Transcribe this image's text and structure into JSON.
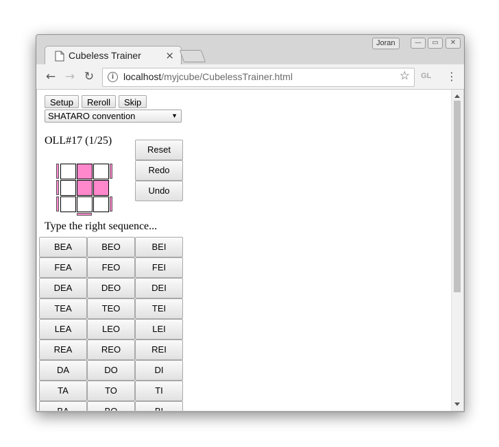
{
  "browser": {
    "tab_title": "Cubeless Trainer",
    "tab_close": "×",
    "profile_name": "Joran",
    "url_host": "localhost",
    "url_path": "/myjcube/CubelessTrainer.html",
    "gl_label": "GL",
    "back_glyph": "←",
    "forward_glyph": "→",
    "reload_glyph": "↻",
    "star_glyph": "☆",
    "menu_glyph": "⋮",
    "info_glyph": "i",
    "minimize_glyph": "—",
    "maximize_glyph": "▭",
    "close_glyph": "✕"
  },
  "controls": {
    "setup": "Setup",
    "reroll": "Reroll",
    "skip": "Skip",
    "convention": "SHATARO convention",
    "dropdown_arrow": "▼"
  },
  "case": {
    "title": "OLL#17 (1/25)",
    "top_cells": [
      false,
      true,
      false,
      false,
      true,
      true,
      false,
      false,
      false
    ],
    "side_color": "#ff88cc",
    "reset": "Reset",
    "redo": "Redo",
    "undo": "Undo"
  },
  "prompt": "Type the right sequence...",
  "sequences": [
    [
      "BEA",
      "BEO",
      "BEI"
    ],
    [
      "FEA",
      "FEO",
      "FEI"
    ],
    [
      "DEA",
      "DEO",
      "DEI"
    ],
    [
      "TEA",
      "TEO",
      "TEI"
    ],
    [
      "LEA",
      "LEO",
      "LEI"
    ],
    [
      "REA",
      "REO",
      "REI"
    ],
    [
      "DA",
      "DO",
      "DI"
    ],
    [
      "TA",
      "TO",
      "TI"
    ],
    [
      "BA",
      "BO",
      "BI"
    ]
  ]
}
